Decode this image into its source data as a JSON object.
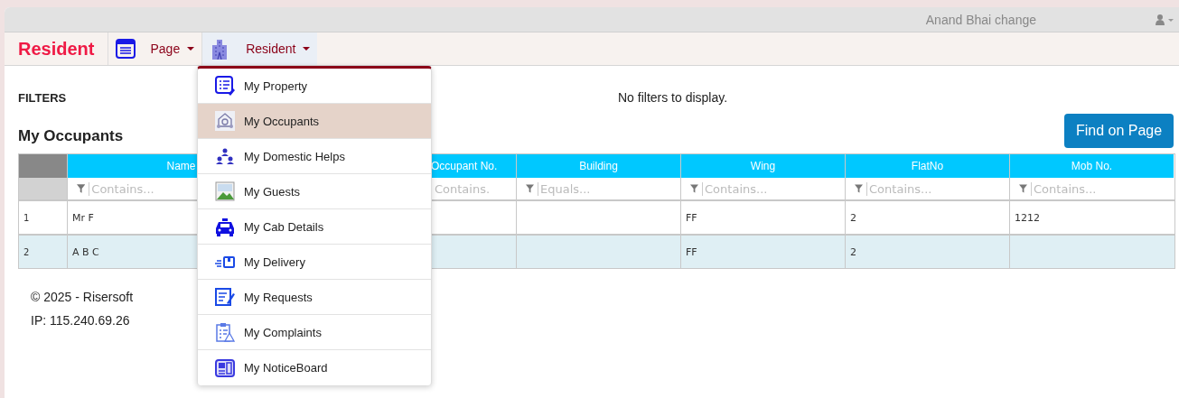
{
  "top_bar": {
    "user_name": "Anand Bhai change"
  },
  "navbar": {
    "brand": "Resident",
    "menus": [
      {
        "label": "Page",
        "selected": false
      },
      {
        "label": "Resident",
        "selected": true
      }
    ]
  },
  "dropdown": {
    "items": [
      {
        "label": "My Property",
        "selected": false
      },
      {
        "label": "My Occupants",
        "selected": true
      },
      {
        "label": "My Domestic Helps",
        "selected": false
      },
      {
        "label": "My Guests",
        "selected": false
      },
      {
        "label": "My Cab Details",
        "selected": false
      },
      {
        "label": "My Delivery",
        "selected": false
      },
      {
        "label": "My Requests",
        "selected": false
      },
      {
        "label": "My Complaints",
        "selected": false
      },
      {
        "label": "My NoticeBoard",
        "selected": false
      }
    ]
  },
  "filters": {
    "heading": "FILTERS",
    "message": "No filters to display."
  },
  "find_button": "Find on Page",
  "grid": {
    "title": "My Occupants",
    "columns": [
      {
        "header": "Name",
        "placeholder": "Contains...",
        "funnel": true
      },
      {
        "header": "Occupant No.",
        "placeholder": "Contains.",
        "funnel": false
      },
      {
        "header": "Building",
        "placeholder": "Equals...",
        "funnel": true
      },
      {
        "header": "Wing",
        "placeholder": "Contains...",
        "funnel": true
      },
      {
        "header": "FlatNo",
        "placeholder": "Contains...",
        "funnel": true
      },
      {
        "header": "Mob No.",
        "placeholder": "Contains...",
        "funnel": true
      }
    ],
    "rows": [
      {
        "index": "1",
        "cells": [
          "Mr F",
          null,
          null,
          "FF",
          "2",
          "1212"
        ]
      },
      {
        "index": "2",
        "cells": [
          "A B C",
          null,
          null,
          "FF",
          "2",
          null
        ]
      }
    ]
  },
  "footer": {
    "copyright": "© 2025 - Risersoft",
    "ip": "IP: 115.240.69.26"
  }
}
